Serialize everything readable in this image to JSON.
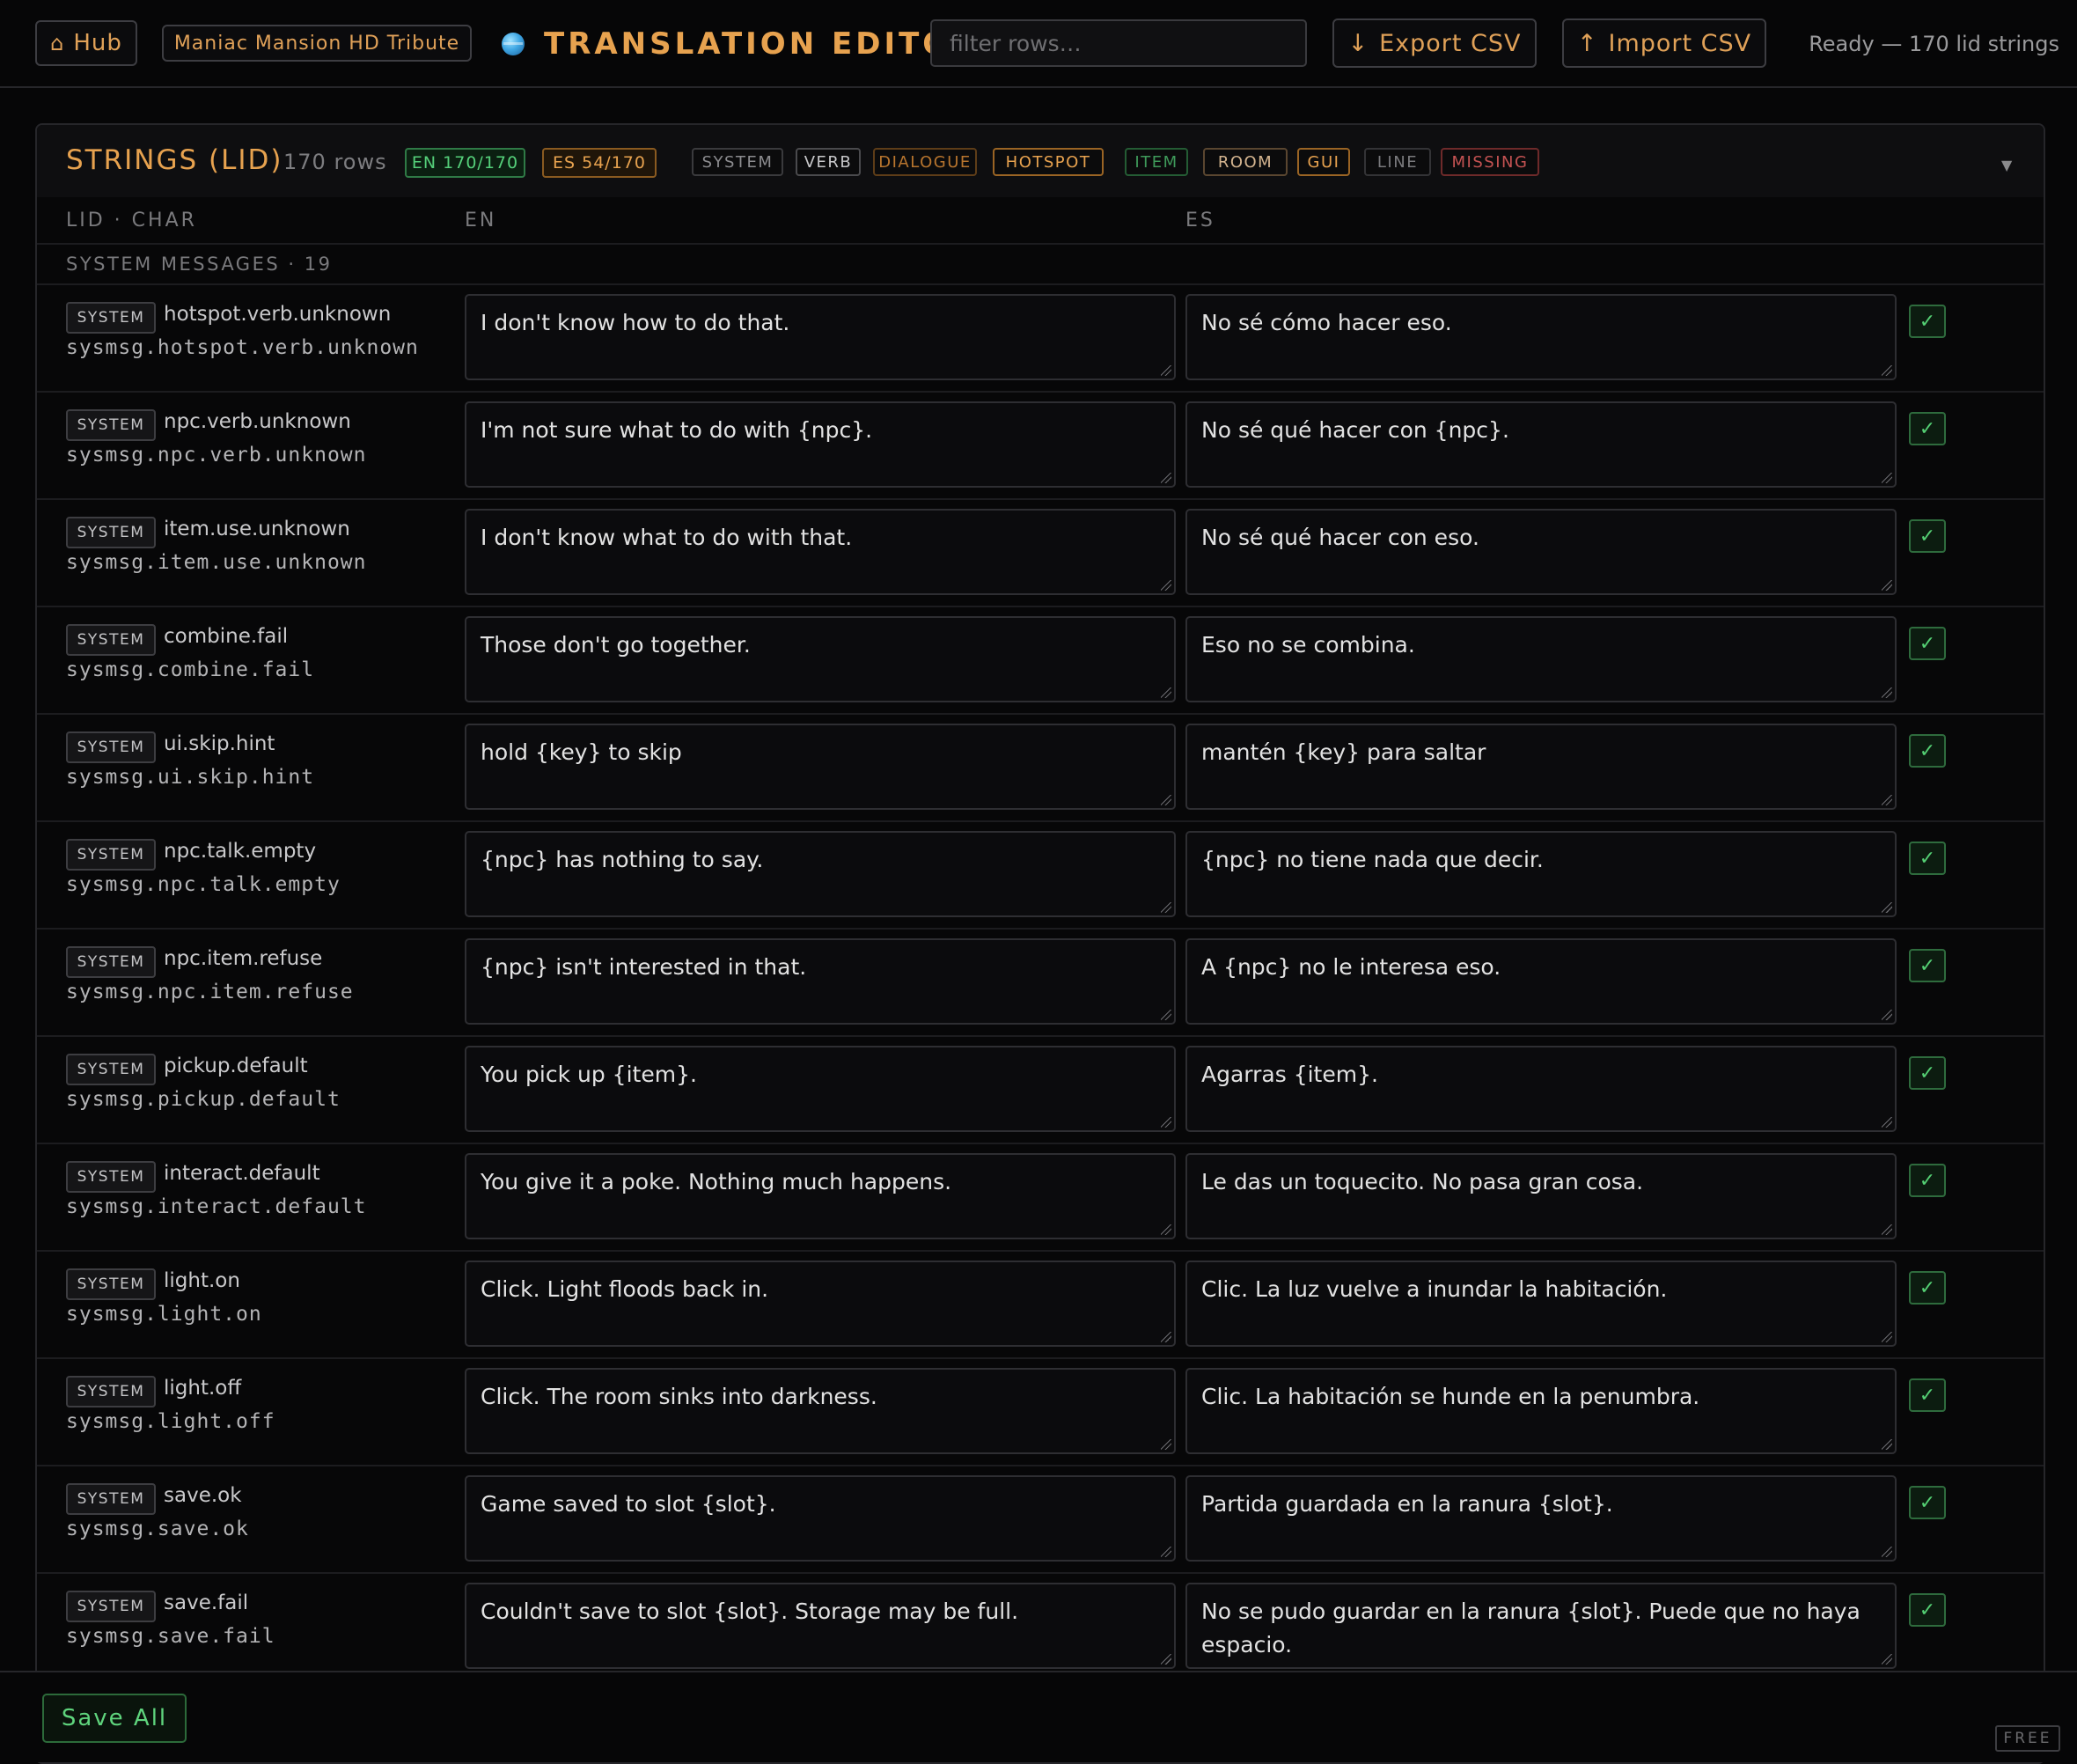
{
  "header": {
    "hub_label": "Hub",
    "hub_icon": "home-icon",
    "project_label": "Maniac Mansion HD Tribute",
    "app_title": "TRANSLATION EDITOR",
    "app_icon": "globe-icon",
    "filter_placeholder": "filter rows…",
    "export_label": "Export CSV",
    "export_icon": "↓",
    "import_label": "Import CSV",
    "import_icon": "↑",
    "status": "Ready — 170 lid strings"
  },
  "panel": {
    "title": "STRINGS (LID)",
    "row_count": "170 rows",
    "progress": [
      {
        "label": "EN 170/170",
        "done": 170,
        "total": 170,
        "color": "#55d07a"
      },
      {
        "label": "ES 54/170",
        "done": 54,
        "total": 170,
        "color": "#e7a24f"
      }
    ],
    "filter_chips": [
      {
        "label": "SYSTEM",
        "color": "#8c8c8f",
        "border": "#3a3a3d"
      },
      {
        "label": "VERB",
        "color": "#c8c8ca",
        "border": "#4a4a4d"
      },
      {
        "label": "DIALOGUE",
        "color": "#b8752e",
        "border": "#5e3d18"
      },
      {
        "label": "HOTSPOT",
        "color": "#e7a24f",
        "border": "#9a6424"
      },
      {
        "label": "ITEM",
        "color": "#3f9a5a",
        "border": "#245c34"
      },
      {
        "label": "ROOM",
        "color": "#d3b48f",
        "border": "#5a4630"
      },
      {
        "label": "GUI",
        "color": "#e7a24f",
        "border": "#9a6424"
      },
      {
        "label": "LINE",
        "color": "#7a7a7d",
        "border": "#333336"
      },
      {
        "label": "MISSING",
        "color": "#c45252",
        "border": "#6e2a2a"
      }
    ],
    "columns": {
      "id": "LID · CHAR",
      "en": "EN",
      "es": "ES"
    },
    "group": "SYSTEM MESSAGES · 19"
  },
  "rows": [
    {
      "tag": "SYSTEM",
      "short": "hotspot.verb.unknown",
      "full": "sysmsg.hotspot.verb.unknown",
      "en": "I don't know how to do that.",
      "es": "No sé cómo hacer eso.",
      "check": "✓"
    },
    {
      "tag": "SYSTEM",
      "short": "npc.verb.unknown",
      "full": "sysmsg.npc.verb.unknown",
      "en": "I'm not sure what to do with {npc}.",
      "es": "No sé qué hacer con {npc}.",
      "check": "✓"
    },
    {
      "tag": "SYSTEM",
      "short": "item.use.unknown",
      "full": "sysmsg.item.use.unknown",
      "en": "I don't know what to do with that.",
      "es": "No sé qué hacer con eso.",
      "check": "✓"
    },
    {
      "tag": "SYSTEM",
      "short": "combine.fail",
      "full": "sysmsg.combine.fail",
      "en": "Those don't go together.",
      "es": "Eso no se combina.",
      "check": "✓"
    },
    {
      "tag": "SYSTEM",
      "short": "ui.skip.hint",
      "full": "sysmsg.ui.skip.hint",
      "en": "hold {key} to skip",
      "es": "mantén {key} para saltar",
      "check": "✓"
    },
    {
      "tag": "SYSTEM",
      "short": "npc.talk.empty",
      "full": "sysmsg.npc.talk.empty",
      "en": "{npc} has nothing to say.",
      "es": "{npc} no tiene nada que decir.",
      "check": "✓"
    },
    {
      "tag": "SYSTEM",
      "short": "npc.item.refuse",
      "full": "sysmsg.npc.item.refuse",
      "en": "{npc} isn't interested in that.",
      "es": "A {npc} no le interesa eso.",
      "check": "✓"
    },
    {
      "tag": "SYSTEM",
      "short": "pickup.default",
      "full": "sysmsg.pickup.default",
      "en": "You pick up {item}.",
      "es": "Agarras {item}.",
      "check": "✓"
    },
    {
      "tag": "SYSTEM",
      "short": "interact.default",
      "full": "sysmsg.interact.default",
      "en": "You give it a poke. Nothing much happens.",
      "es": "Le das un toquecito. No pasa gran cosa.",
      "check": "✓"
    },
    {
      "tag": "SYSTEM",
      "short": "light.on",
      "full": "sysmsg.light.on",
      "en": "Click. Light floods back in.",
      "es": "Clic. La luz vuelve a inundar la habitación.",
      "check": "✓"
    },
    {
      "tag": "SYSTEM",
      "short": "light.off",
      "full": "sysmsg.light.off",
      "en": "Click. The room sinks into darkness.",
      "es": "Clic. La habitación se hunde en la penumbra.",
      "check": "✓"
    },
    {
      "tag": "SYSTEM",
      "short": "save.ok",
      "full": "sysmsg.save.ok",
      "en": "Game saved to slot {slot}.",
      "es": "Partida guardada en la ranura {slot}.",
      "check": "✓"
    },
    {
      "tag": "SYSTEM",
      "short": "save.fail",
      "full": "sysmsg.save.fail",
      "en": "Couldn't save to slot {slot}. Storage may be full.",
      "es": "No se pudo guardar en la ranura {slot}. Puede que no haya espacio.",
      "check": "✓"
    }
  ],
  "footer": {
    "save_all_label": "Save All",
    "plan_badge": "FREE"
  }
}
